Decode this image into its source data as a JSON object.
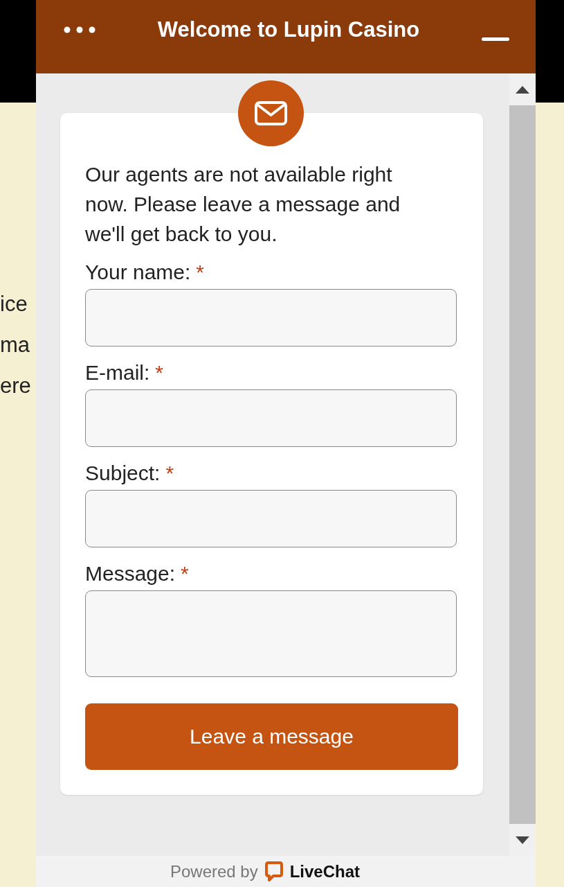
{
  "background_text": [
    "ice",
    "ma",
    "ere"
  ],
  "chat": {
    "title": "Welcome to Lupin Casino",
    "message": "Our agents are not available right now. Please leave a message and we'll get back to you.",
    "fields": [
      {
        "label": "Your name:",
        "required_mark": "*",
        "kind": "input"
      },
      {
        "label": "E-mail:",
        "required_mark": "*",
        "kind": "input"
      },
      {
        "label": "Subject:",
        "required_mark": "*",
        "kind": "input"
      },
      {
        "label": "Message:",
        "required_mark": "*",
        "kind": "textarea"
      }
    ],
    "submit": "Leave a message",
    "footer": {
      "prefix": "Powered by",
      "brand": "LiveChat"
    }
  }
}
